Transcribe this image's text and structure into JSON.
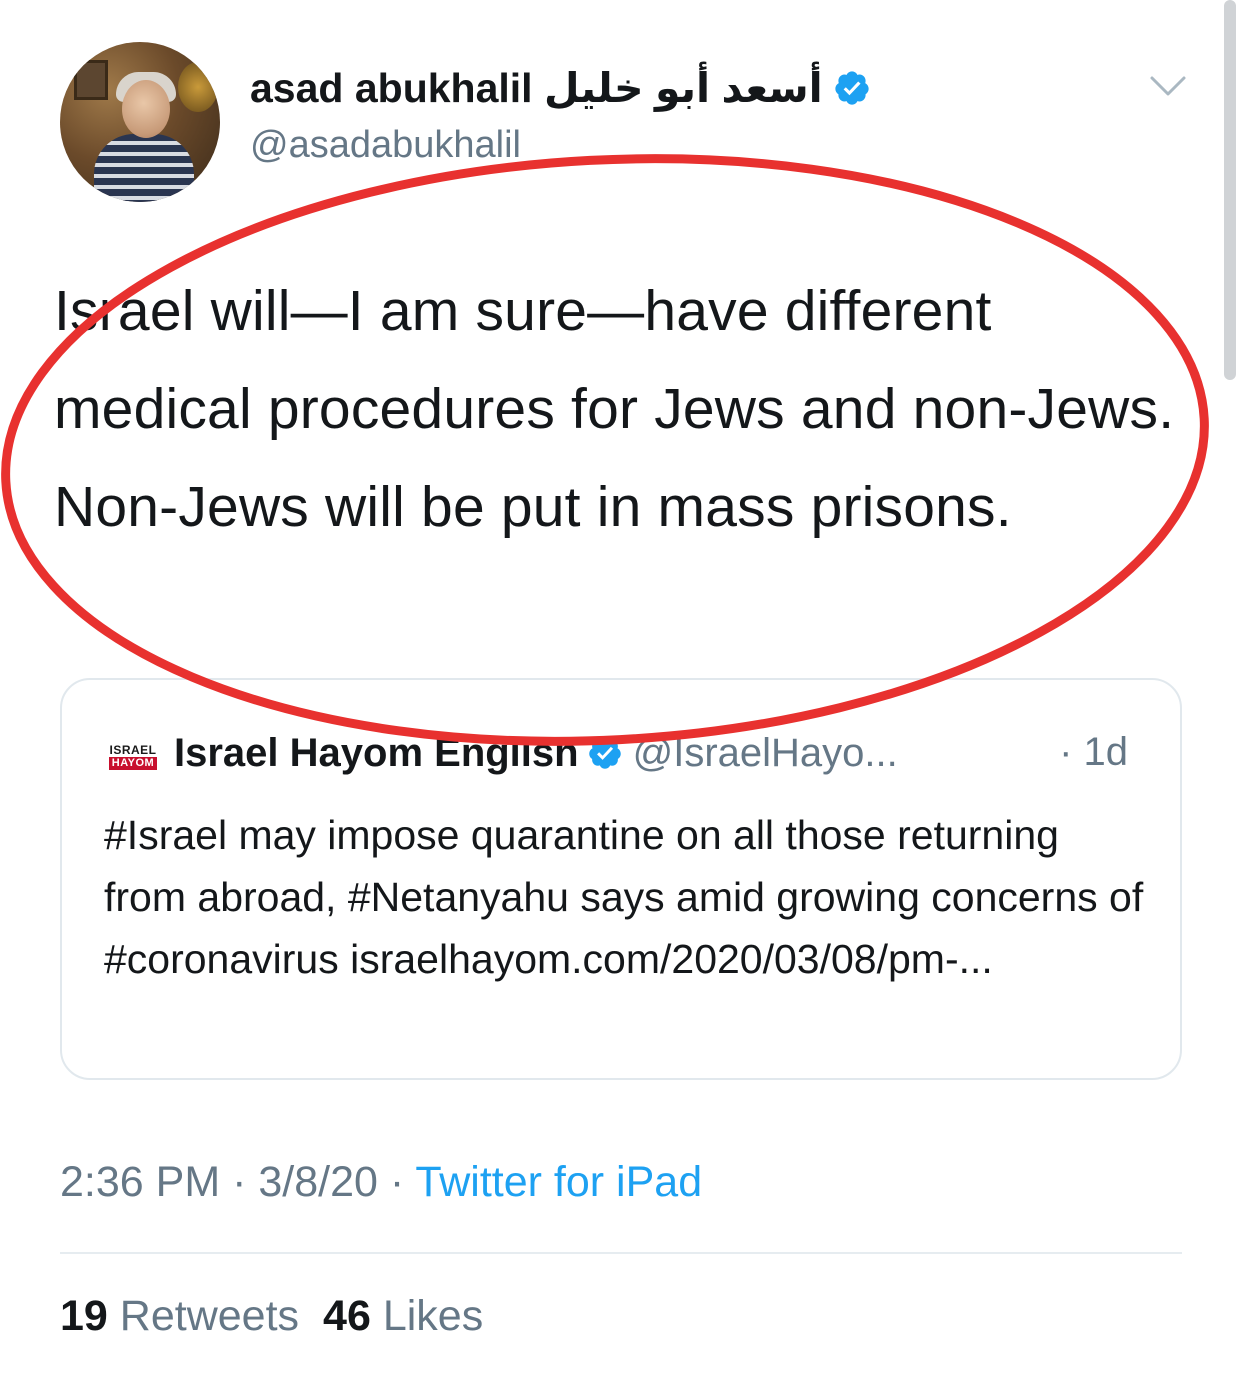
{
  "author": {
    "display_name": "asad abukhalil أسعد أبو خليل",
    "handle": "@asadabukhalil",
    "verified": true
  },
  "tweet": {
    "text": "Israel will—I am sure—have different medical procedures for Jews and non-Jews.  Non-Jews will be put in mass prisons."
  },
  "quoted_tweet": {
    "logo_line1": "ISRAEL",
    "logo_line2": "HAYOM",
    "display_name": "Israel Hayom English",
    "handle": "@IsraelHayo...",
    "time": "· 1d",
    "text": "#Israel may impose quarantine on all those returning from abroad, #Netanyahu says amid growing concerns of #coronavirus israelhayom.com/2020/03/08/pm-..."
  },
  "meta": {
    "time": "2:36 PM",
    "date": "3/8/20",
    "separator": " · ",
    "source": "Twitter for iPad"
  },
  "stats": {
    "retweets_count": "19",
    "retweets_label": "Retweets",
    "likes_count": "46",
    "likes_label": "Likes"
  },
  "colors": {
    "link": "#1da1f2",
    "secondary_text": "#657786",
    "annotation_circle": "#e8312f"
  },
  "icons": {
    "verified": "verified-badge-icon",
    "menu": "chevron-down-icon"
  }
}
